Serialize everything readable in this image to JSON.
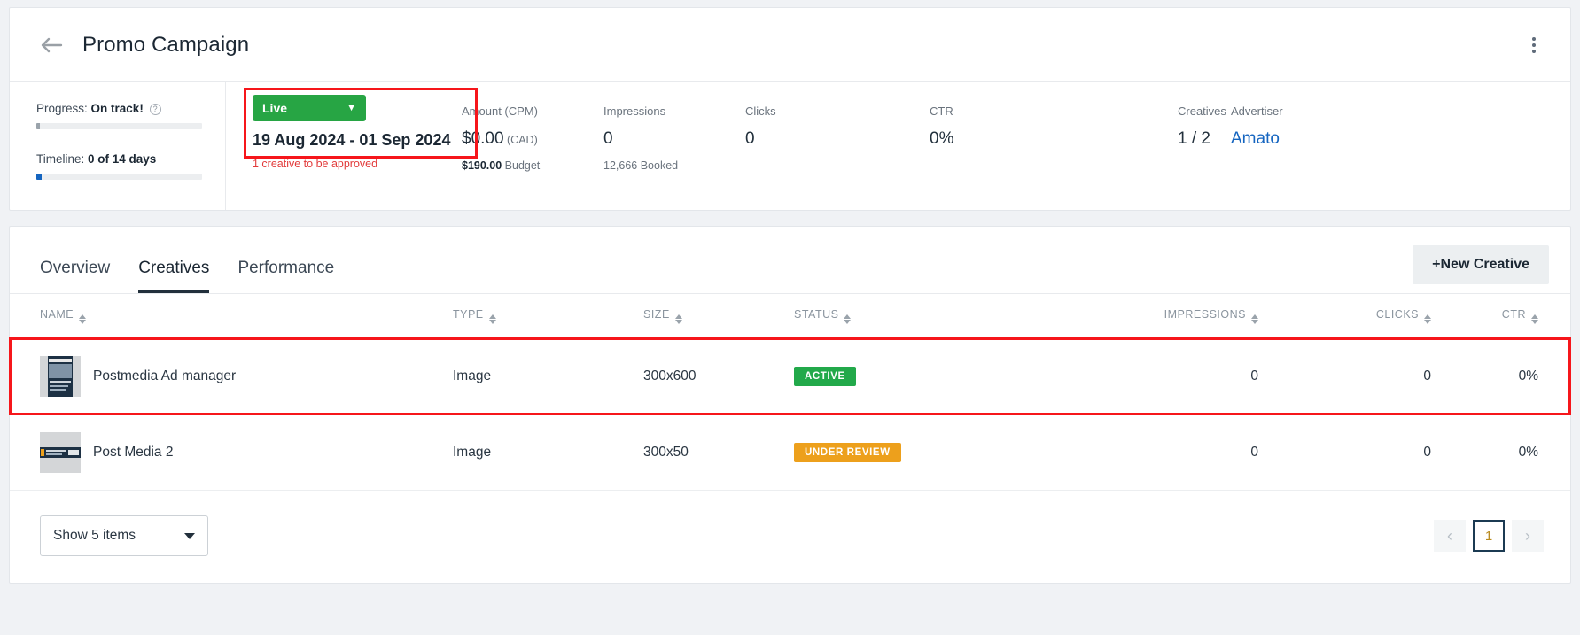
{
  "header": {
    "back_icon": "arrow-left-icon",
    "title": "Promo Campaign",
    "menu_icon": "kebab-menu-icon"
  },
  "stats": {
    "progress": {
      "label_prefix": "Progress:",
      "label_value": "On track!",
      "help_icon": "help-circle-icon",
      "fill_percent": 2,
      "fill_color": "#9aa3ab"
    },
    "timeline": {
      "label_prefix": "Timeline:",
      "label_value": "0 of 14 days",
      "fill_percent": 3,
      "fill_color": "#1565c0"
    },
    "status": {
      "button_label": "Live",
      "button_color": "#27a544",
      "chevron_icon": "chevron-down-icon",
      "date_range": "19 Aug 2024 - 01 Sep 2024",
      "warning": "1 creative to be approved",
      "warning_color": "#e23a3a",
      "highlight_color": "#f6161b"
    },
    "metrics": [
      {
        "label": "Amount (CPM)",
        "value": "$0.00",
        "currency": "(CAD)",
        "sub_strong": "$190.00",
        "sub_rest": " Budget"
      },
      {
        "label": "Impressions",
        "value": "0",
        "currency": "",
        "sub_strong": "",
        "sub_rest": "12,666 Booked"
      },
      {
        "label": "Clicks",
        "value": "0",
        "currency": "",
        "sub_strong": "",
        "sub_rest": ""
      },
      {
        "label": "CTR",
        "value": "0%",
        "currency": "",
        "sub_strong": "",
        "sub_rest": ""
      },
      {
        "label": "Creatives",
        "value": "1 / 2",
        "currency": "",
        "sub_strong": "",
        "sub_rest": ""
      },
      {
        "label": "Advertiser",
        "value": "Amato",
        "currency": "",
        "sub_strong": "",
        "sub_rest": "",
        "is_link": true
      }
    ]
  },
  "tabs": [
    {
      "label": "Overview",
      "active": false
    },
    {
      "label": "Creatives",
      "active": true
    },
    {
      "label": "Performance",
      "active": false
    }
  ],
  "new_creative_button": {
    "plus": "+",
    "label": "New Creative"
  },
  "table": {
    "columns": [
      {
        "label": "NAME",
        "sortable": true
      },
      {
        "label": "TYPE",
        "sortable": true
      },
      {
        "label": "SIZE",
        "sortable": true
      },
      {
        "label": "STATUS",
        "sortable": true
      },
      {
        "label": "IMPRESSIONS",
        "sortable": true
      },
      {
        "label": "CLICKS",
        "sortable": true
      },
      {
        "label": "CTR",
        "sortable": true
      }
    ],
    "rows": [
      {
        "name": "Postmedia Ad manager",
        "type": "Image",
        "size": "300x600",
        "status": "ACTIVE",
        "status_kind": "active",
        "status_color": "#22a94a",
        "impressions": "0",
        "clicks": "0",
        "ctr": "0%",
        "thumb_kind": "tall-portrait-ad",
        "highlighted": true
      },
      {
        "name": "Post Media 2",
        "type": "Image",
        "size": "300x50",
        "status": "UNDER REVIEW",
        "status_kind": "review",
        "status_color": "#eda01c",
        "impressions": "0",
        "clicks": "0",
        "ctr": "0%",
        "thumb_kind": "wide-banner-ad",
        "highlighted": false
      }
    ]
  },
  "footer": {
    "page_size_label": "Show 5 items",
    "prev_icon": "chevron-left-icon",
    "next_icon": "chevron-right-icon",
    "current_page": "1"
  }
}
